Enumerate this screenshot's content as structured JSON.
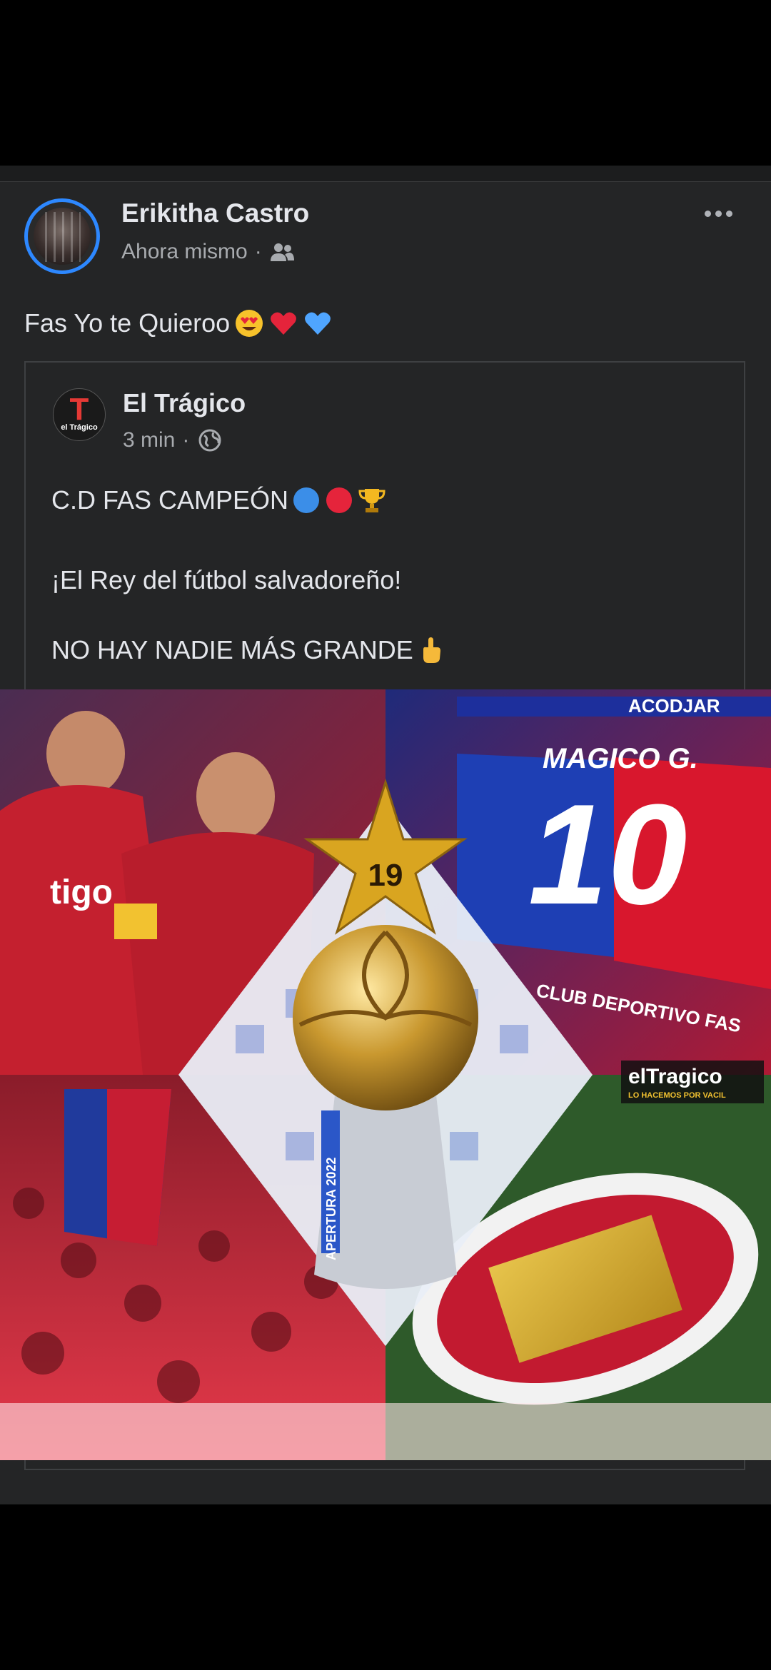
{
  "post": {
    "author": "Erikitha Castro",
    "timestamp": "Ahora mismo",
    "audience_icon": "friends-icon",
    "text": "Fas Yo te Quieroo",
    "emojis": [
      "heart-eyes-emoji",
      "red-heart-emoji",
      "blue-heart-emoji"
    ]
  },
  "shared": {
    "author": "El Trágico",
    "logo_letter": "T",
    "logo_caption": "el Trágico",
    "timestamp": "3 min",
    "audience_icon": "globe-icon",
    "line1": "C.D FAS CAMPEÓN",
    "line1_emojis": [
      "blue-circle-emoji",
      "red-circle-emoji",
      "trophy-emoji"
    ],
    "line2": "¡El Rey del fútbol salvadoreño!",
    "line3": "NO HAY NADIE MÁS GRANDE",
    "line3_emoji": "pointing-up-emoji"
  },
  "image": {
    "star_number": "19",
    "banner_text": "MAGICO G.",
    "banner_number": "10",
    "sponsor_top": "ACODJAR",
    "stadium_text": "CLUB DEPORTIVO FAS",
    "watermark": "elTragico",
    "watermark_sub": "LO HACEMOS POR VACIL",
    "trophy_ribbon": "APERTURA 2022",
    "jersey_sponsor": "tigo"
  },
  "colors": {
    "background": "#242526",
    "accent_blue": "#2d88ff",
    "text_primary": "#e4e6eb",
    "text_secondary": "#a8abaf"
  }
}
